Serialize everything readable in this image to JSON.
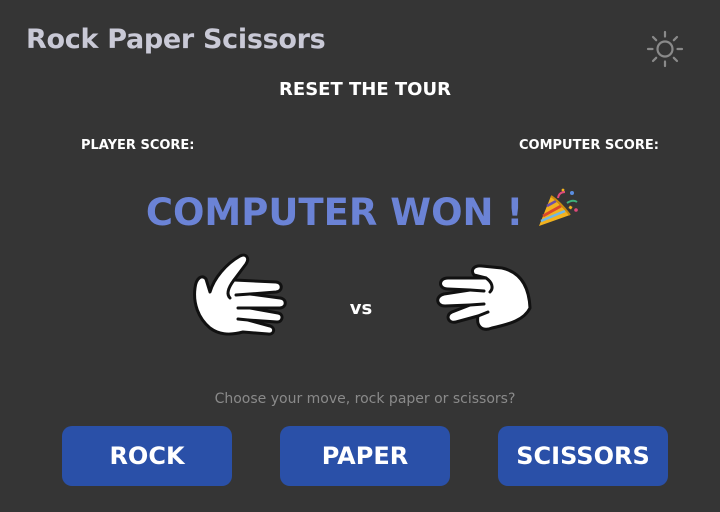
{
  "header": {
    "title": "Rock Paper Scissors",
    "theme_icon": "sun-icon"
  },
  "reset_label": "RESET THE TOUR",
  "scores": {
    "player_label": "PLAYER SCORE:",
    "player_value": "",
    "computer_label": "COMPUTER SCORE:",
    "computer_value": ""
  },
  "result": {
    "text": "COMPUTER WON !",
    "emoji": "party-popper-icon"
  },
  "round": {
    "player_hand_icon": "paper-hand-icon",
    "vs_label": "vs",
    "computer_hand_icon": "rock-fist-icon"
  },
  "prompt": "Choose your move, rock paper or scissors?",
  "moves": {
    "rock_label": "ROCK",
    "paper_label": "PAPER",
    "scissors_label": "SCISSORS"
  },
  "colors": {
    "background": "#353535",
    "title": "#c9c9d6",
    "result": "#6b83d6",
    "button": "#2a50a8",
    "prompt": "#8a8a8a"
  }
}
